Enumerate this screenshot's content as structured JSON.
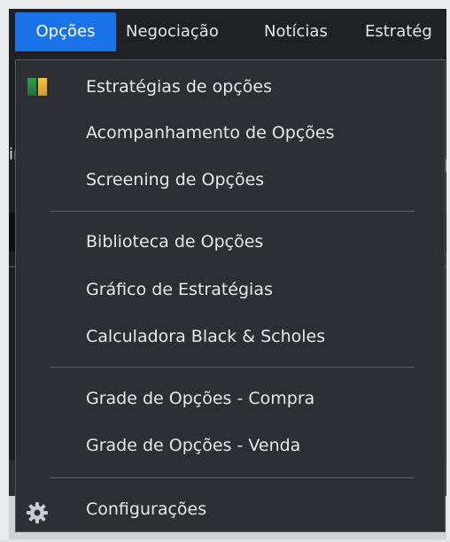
{
  "menubar": {
    "items": [
      {
        "label": "Opções",
        "active": true
      },
      {
        "label": "Negociação"
      },
      {
        "label": "Notícias"
      },
      {
        "label": "Estratég"
      }
    ]
  },
  "dropdown": {
    "items": [
      {
        "label": "Estratégias de opções",
        "icon": "strategies-icon"
      },
      {
        "label": "Acompanhamento de Opções"
      },
      {
        "label": "Screening de Opções"
      },
      {
        "label": "Biblioteca de Opções"
      },
      {
        "label": "Gráfico de Estratégias"
      },
      {
        "label": "Calculadora Black & Scholes"
      },
      {
        "label": "Grade de Opções - Compra"
      },
      {
        "label": "Grade de Opções - Venda"
      },
      {
        "label": "Configurações",
        "icon": "gear-icon"
      }
    ]
  },
  "background": {
    "partial_char": "ir"
  },
  "colors": {
    "menu_bg": "#2c2f33",
    "active_tab": "#1a73e8",
    "text": "#e8e8e8",
    "separator": "#5a5d61"
  }
}
